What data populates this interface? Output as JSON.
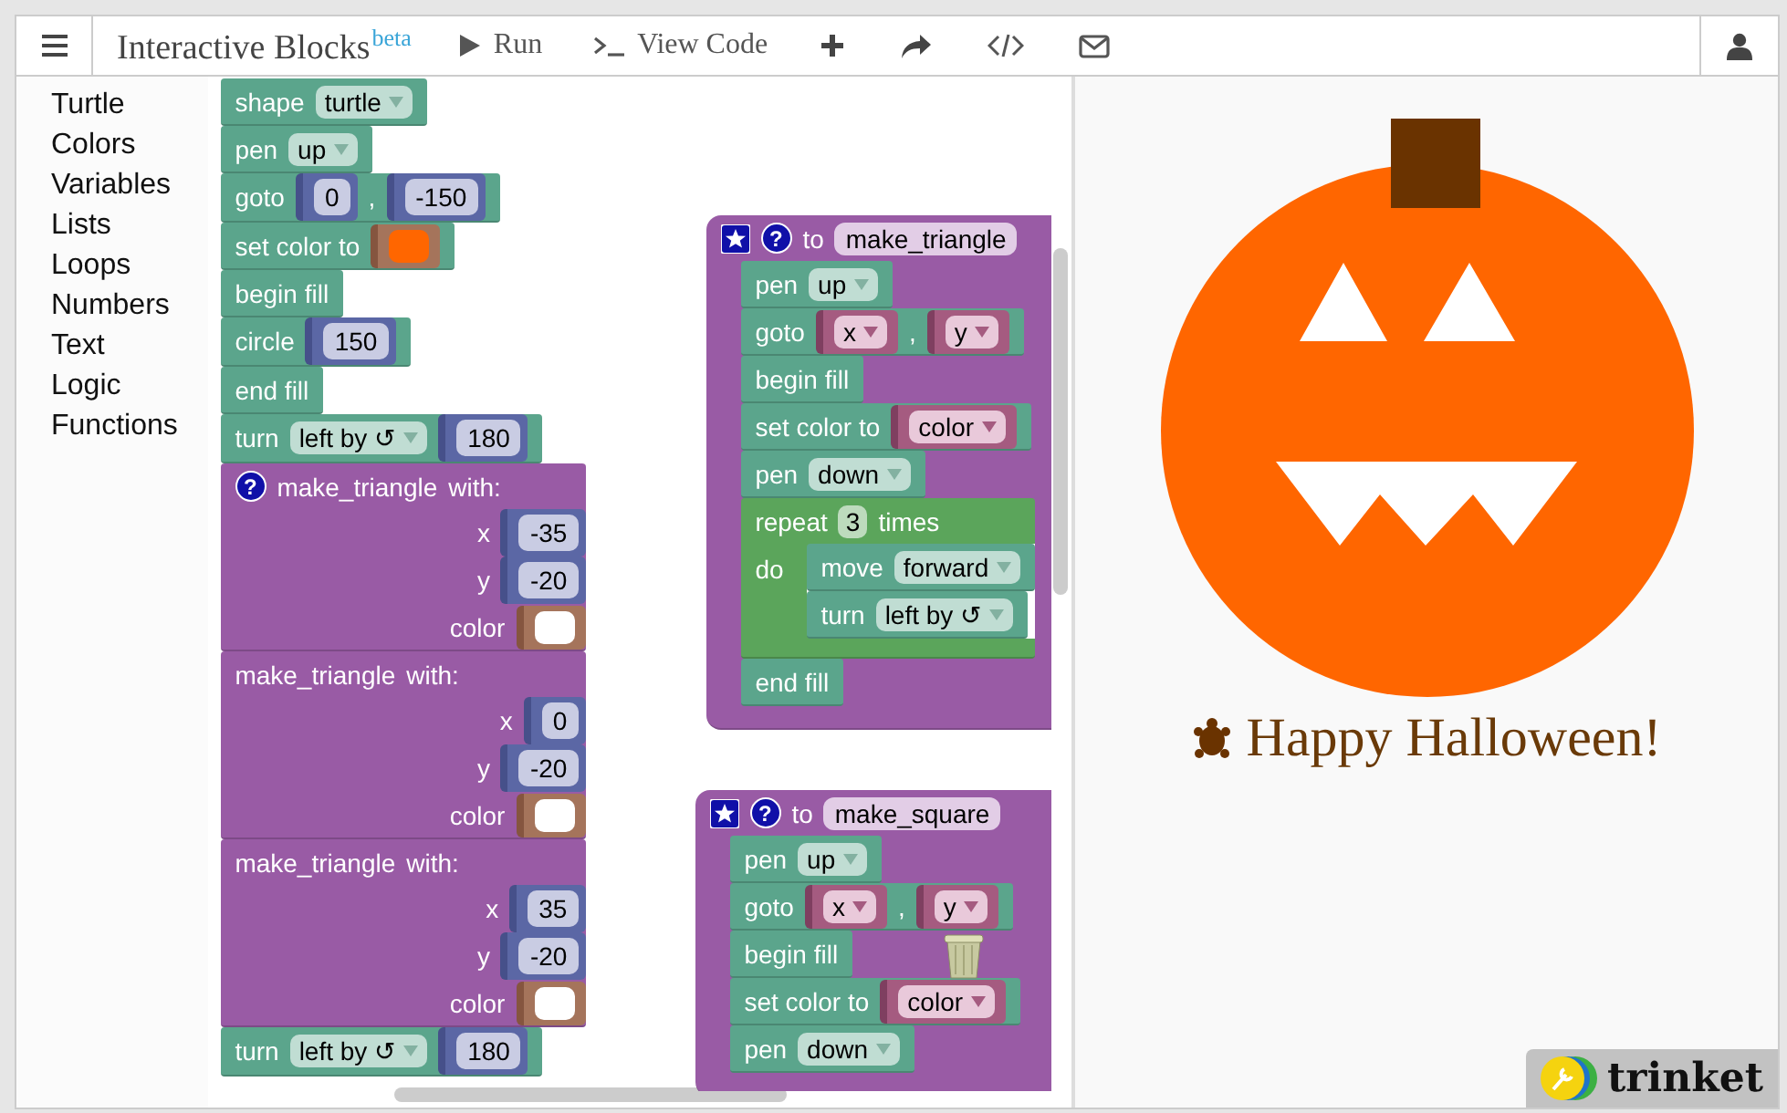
{
  "header": {
    "title": "Interactive Blocks",
    "badge": "beta",
    "actions": [
      {
        "kind": "run",
        "label": "Run"
      },
      {
        "kind": "code",
        "label": "View Code"
      },
      {
        "kind": "add"
      },
      {
        "kind": "share"
      },
      {
        "kind": "embed"
      },
      {
        "kind": "email"
      }
    ]
  },
  "toolbox": {
    "categories": [
      "Turtle",
      "Colors",
      "Variables",
      "Lists",
      "Loops",
      "Numbers",
      "Text",
      "Logic",
      "Functions"
    ]
  },
  "workspace": {
    "stacks": [
      [
        {
          "kind": "statement",
          "parts": [
            {
              "kind": "label",
              "text": "shape"
            },
            {
              "kind": "dropdown",
              "text": "turtle"
            }
          ]
        },
        {
          "kind": "statement",
          "parts": [
            {
              "kind": "label",
              "text": "pen"
            },
            {
              "kind": "dropdown",
              "text": "up"
            }
          ]
        },
        {
          "kind": "statement",
          "parts": [
            {
              "kind": "label",
              "text": "goto"
            },
            {
              "kind": "number",
              "text": "0"
            },
            {
              "kind": "label",
              "text": ","
            },
            {
              "kind": "number",
              "text": "-150"
            }
          ]
        },
        {
          "kind": "statement",
          "parts": [
            {
              "kind": "label",
              "text": "set color to"
            },
            {
              "kind": "colour",
              "color": "#ff6600"
            }
          ]
        },
        {
          "kind": "statement",
          "parts": [
            {
              "kind": "label",
              "text": "begin fill"
            }
          ]
        },
        {
          "kind": "statement",
          "parts": [
            {
              "kind": "label",
              "text": "circle"
            },
            {
              "kind": "number",
              "text": "150"
            }
          ]
        },
        {
          "kind": "statement",
          "parts": [
            {
              "kind": "label",
              "text": "end fill"
            }
          ]
        },
        {
          "kind": "statement",
          "parts": [
            {
              "kind": "label",
              "text": "turn"
            },
            {
              "kind": "dropdown",
              "text": "left by ↺"
            },
            {
              "kind": "number",
              "text": "180"
            }
          ]
        },
        {
          "kind": "call",
          "parts": [
            {
              "kind": "help",
              "text": "?"
            },
            {
              "kind": "label",
              "text": "make_triangle"
            },
            {
              "kind": "label",
              "text": "with:"
            }
          ],
          "args": [
            {
              "label": "x",
              "input": {
                "kind": "number",
                "text": "-35"
              }
            },
            {
              "label": "y",
              "input": {
                "kind": "number",
                "text": "-20"
              }
            },
            {
              "label": "color",
              "input": {
                "kind": "colour",
                "color": "#ffffff"
              }
            }
          ]
        },
        {
          "kind": "call",
          "parts": [
            {
              "kind": "label",
              "text": "make_triangle"
            },
            {
              "kind": "label",
              "text": "with:"
            }
          ],
          "args": [
            {
              "label": "x",
              "input": {
                "kind": "number",
                "text": "0"
              }
            },
            {
              "label": "y",
              "input": {
                "kind": "number",
                "text": "-20"
              }
            },
            {
              "label": "color",
              "input": {
                "kind": "colour",
                "color": "#ffffff"
              }
            }
          ]
        },
        {
          "kind": "call",
          "parts": [
            {
              "kind": "label",
              "text": "make_triangle"
            },
            {
              "kind": "label",
              "text": "with:"
            }
          ],
          "args": [
            {
              "label": "x",
              "input": {
                "kind": "number",
                "text": "35"
              }
            },
            {
              "label": "y",
              "input": {
                "kind": "number",
                "text": "-20"
              }
            },
            {
              "label": "color",
              "input": {
                "kind": "colour",
                "color": "#ffffff"
              }
            }
          ]
        },
        {
          "kind": "statement",
          "parts": [
            {
              "kind": "label",
              "text": "turn"
            },
            {
              "kind": "dropdown",
              "text": "left by ↺"
            },
            {
              "kind": "number",
              "text": "180"
            }
          ]
        }
      ],
      [
        {
          "kind": "definition",
          "parts": [
            {
              "kind": "star"
            },
            {
              "kind": "help",
              "text": "?"
            },
            {
              "kind": "label",
              "text": "to"
            },
            {
              "kind": "name",
              "text": "make_triangle"
            }
          ],
          "body": [
            {
              "kind": "statement",
              "parts": [
                {
                  "kind": "label",
                  "text": "pen"
                },
                {
                  "kind": "dropdown",
                  "text": "up"
                }
              ]
            },
            {
              "kind": "statement",
              "parts": [
                {
                  "kind": "label",
                  "text": "goto"
                },
                {
                  "kind": "variable",
                  "text": "x"
                },
                {
                  "kind": "label",
                  "text": ","
                },
                {
                  "kind": "variable",
                  "text": "y"
                }
              ]
            },
            {
              "kind": "statement",
              "parts": [
                {
                  "kind": "label",
                  "text": "begin fill"
                }
              ]
            },
            {
              "kind": "statement",
              "parts": [
                {
                  "kind": "label",
                  "text": "set color to"
                },
                {
                  "kind": "variable",
                  "text": "color"
                }
              ]
            },
            {
              "kind": "statement",
              "parts": [
                {
                  "kind": "label",
                  "text": "pen"
                },
                {
                  "kind": "dropdown",
                  "text": "down"
                }
              ]
            },
            {
              "kind": "repeat",
              "parts": [
                {
                  "kind": "label",
                  "text": "repeat"
                },
                {
                  "kind": "count",
                  "text": "3"
                },
                {
                  "kind": "label",
                  "text": "times"
                }
              ],
              "do": "do",
              "body": [
                {
                  "kind": "statement",
                  "parts": [
                    {
                      "kind": "label",
                      "text": "move"
                    },
                    {
                      "kind": "dropdown",
                      "text": "forward"
                    }
                  ]
                },
                {
                  "kind": "statement",
                  "parts": [
                    {
                      "kind": "label",
                      "text": "turn"
                    },
                    {
                      "kind": "dropdown",
                      "text": "left by ↺"
                    }
                  ]
                }
              ]
            },
            {
              "kind": "statement",
              "parts": [
                {
                  "kind": "label",
                  "text": "end fill"
                }
              ]
            }
          ]
        }
      ],
      [
        {
          "kind": "definition",
          "parts": [
            {
              "kind": "star"
            },
            {
              "kind": "help",
              "text": "?"
            },
            {
              "kind": "label",
              "text": "to"
            },
            {
              "kind": "name",
              "text": "make_square"
            }
          ],
          "body": [
            {
              "kind": "statement",
              "parts": [
                {
                  "kind": "label",
                  "text": "pen"
                },
                {
                  "kind": "dropdown",
                  "text": "up"
                }
              ]
            },
            {
              "kind": "statement",
              "parts": [
                {
                  "kind": "label",
                  "text": "goto"
                },
                {
                  "kind": "variable",
                  "text": "x"
                },
                {
                  "kind": "label",
                  "text": ","
                },
                {
                  "kind": "variable",
                  "text": "y"
                }
              ]
            },
            {
              "kind": "statement",
              "parts": [
                {
                  "kind": "label",
                  "text": "begin fill"
                }
              ]
            },
            {
              "kind": "statement",
              "parts": [
                {
                  "kind": "label",
                  "text": "set color to"
                },
                {
                  "kind": "variable",
                  "text": "color"
                }
              ]
            },
            {
              "kind": "statement",
              "parts": [
                {
                  "kind": "label",
                  "text": "pen"
                },
                {
                  "kind": "dropdown",
                  "text": "down"
                }
              ]
            }
          ]
        }
      ]
    ]
  },
  "output": {
    "caption": "Happy Halloween!",
    "brand": "trinket"
  }
}
